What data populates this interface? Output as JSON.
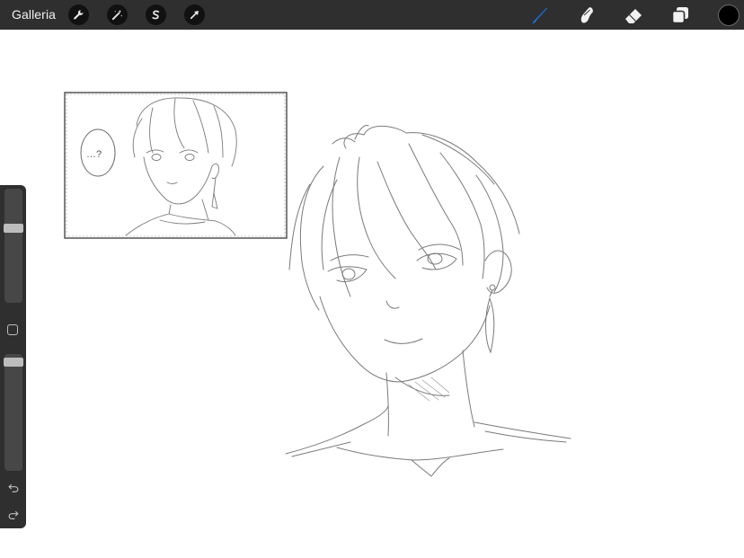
{
  "topbar": {
    "gallery_label": "Galleria",
    "left_tools": [
      {
        "name": "actions-wrench-icon"
      },
      {
        "name": "adjustments-magic-wand-icon"
      },
      {
        "name": "selection-s-icon"
      },
      {
        "name": "transform-arrow-icon"
      }
    ],
    "right_tools": [
      {
        "name": "brush-icon",
        "active": true,
        "color": "#1a73e8"
      },
      {
        "name": "smudge-icon"
      },
      {
        "name": "eraser-icon"
      },
      {
        "name": "layers-icon"
      }
    ],
    "current_color": "#000000"
  },
  "sidebar": {
    "brush_size_level": 0.67,
    "opacity_level": 0.97,
    "icons": [
      "modify-square-icon",
      "undo-icon",
      "redo-icon"
    ]
  },
  "colors": {
    "toolbar_bg": "#2f2f2f",
    "canvas_bg": "#ffffff",
    "sketch_stroke": "#7a7a7a",
    "active_tool": "#1a73e8"
  },
  "canvas": {
    "speech_bubble_text": "…?"
  }
}
